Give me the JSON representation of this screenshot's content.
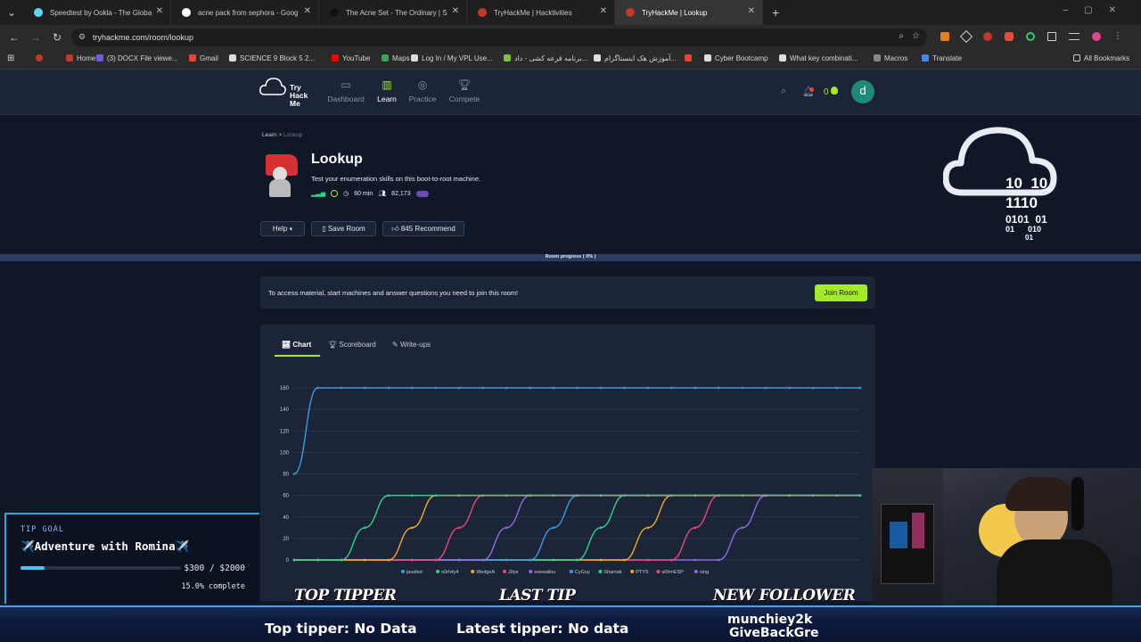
{
  "browser": {
    "tabs": [
      {
        "title": "Speedtest by Ookla - The Globa",
        "color": "#5ad7ff"
      },
      {
        "title": "acne pack from sephora - Goog",
        "color": "#ffffff"
      },
      {
        "title": "The Acne Set - The Ordinary | S",
        "color": "#111111"
      },
      {
        "title": "TryHackMe | Hacktivities",
        "color": "#c0392b"
      },
      {
        "title": "TryHackMe | Lookup",
        "color": "#c0392b"
      }
    ],
    "new_tab": "+",
    "url": "tryhackme.com/room/lookup",
    "bookmarks": [
      {
        "label": "Home",
        "color": "#c0392b"
      },
      {
        "label": "(3) DOCX File viewe...",
        "color": "#6c5ce7"
      },
      {
        "label": "Gmail",
        "color": "#ea4335"
      },
      {
        "label": "SCIENCE 9 Block 5 2...",
        "color": "#dddddd"
      },
      {
        "label": "YouTube",
        "color": "#ff0000"
      },
      {
        "label": "Maps",
        "color": "#34a853"
      },
      {
        "label": "Log In / My VPL Use...",
        "color": "#dddddd"
      },
      {
        "label": "برنامه قرعه کشی - داد...",
        "color": "#7cc242"
      },
      {
        "label": "آموزش هک اینستاگرام...",
        "color": "#dddddd"
      },
      {
        "label": "",
        "color": "#ea4335"
      },
      {
        "label": "Cyber Bootcamp",
        "color": "#dddddd"
      },
      {
        "label": "What key combinati...",
        "color": "#dddddd"
      },
      {
        "label": "Macros",
        "color": "#888888"
      },
      {
        "label": "Translate",
        "color": "#4285f4"
      }
    ],
    "all_bookmarks": "All Bookmarks"
  },
  "site": {
    "logo_text": "Try Hack Me",
    "nav": [
      {
        "label": "Dashboard",
        "icon": "dashboard-icon",
        "active": false
      },
      {
        "label": "Learn",
        "icon": "learn-icon",
        "active": true
      },
      {
        "label": "Practice",
        "icon": "practice-icon",
        "active": false
      },
      {
        "label": "Compete",
        "icon": "compete-icon",
        "active": false
      }
    ],
    "points": "0",
    "avatar_letter": "d",
    "accent": "#a3ea2a"
  },
  "room": {
    "breadcrumb": {
      "parent": "Learn",
      "separator": ">",
      "current": "Lookup"
    },
    "title": "Lookup",
    "description": "Test your enumeration skills on this boot-to-root machine.",
    "duration": "60 min",
    "users": "82,173",
    "buttons": {
      "help": "Help",
      "save": "Save Room",
      "recommend": "845 Recommend"
    },
    "progress_label": "Room progress ( 0% )",
    "progress": 0,
    "join_text": "To access material, start machines and answer questions you need to join this room!",
    "join_button": "Join Room",
    "binary_art": [
      "10  10",
      "1110",
      "0101  01",
      "01      010",
      "01"
    ]
  },
  "chart_tabs": [
    {
      "label": "Chart",
      "active": true
    },
    {
      "label": "Scoreboard",
      "active": false
    },
    {
      "label": "Write-ups",
      "active": false
    }
  ],
  "chart_data": {
    "type": "line",
    "title": "",
    "xlabel": "",
    "ylabel": "",
    "ylim": [
      0,
      160
    ],
    "yticks": [
      0,
      20,
      40,
      60,
      80,
      100,
      120,
      140,
      160
    ],
    "grid": true,
    "legend_position": "bottom",
    "points_per_series": 25,
    "series": [
      {
        "name": "jaxafed",
        "color": "#3b9ae1",
        "values": [
          80,
          160,
          160,
          160,
          160,
          160,
          160,
          160,
          160,
          160,
          160,
          160,
          160,
          160,
          160,
          160,
          160,
          160,
          160,
          160,
          160,
          160,
          160,
          160,
          160
        ]
      },
      {
        "name": "s0rh4y4",
        "color": "#2fd08a",
        "values": [
          0,
          0,
          0,
          30,
          60,
          60,
          60,
          60,
          60,
          60,
          60,
          60,
          60,
          60,
          60,
          60,
          60,
          60,
          60,
          60,
          60,
          60,
          60,
          60,
          60
        ]
      },
      {
        "name": "WedgeA",
        "color": "#f0a72b",
        "values": [
          0,
          0,
          0,
          0,
          0,
          30,
          60,
          60,
          60,
          60,
          60,
          60,
          60,
          60,
          60,
          60,
          60,
          60,
          60,
          60,
          60,
          60,
          60,
          60,
          60
        ]
      },
      {
        "name": "J0ye",
        "color": "#e8467c",
        "values": [
          0,
          0,
          0,
          0,
          0,
          0,
          0,
          30,
          60,
          60,
          60,
          60,
          60,
          60,
          60,
          60,
          60,
          60,
          60,
          60,
          60,
          60,
          60,
          60,
          60
        ]
      },
      {
        "name": "sowsaliou",
        "color": "#8e6be3",
        "values": [
          0,
          0,
          0,
          0,
          0,
          0,
          0,
          0,
          0,
          30,
          60,
          60,
          60,
          60,
          60,
          60,
          60,
          60,
          60,
          60,
          60,
          60,
          60,
          60,
          60
        ]
      },
      {
        "name": "CyGuy",
        "color": "#3b9ae1",
        "values": [
          0,
          0,
          0,
          0,
          0,
          0,
          0,
          0,
          0,
          0,
          0,
          30,
          60,
          60,
          60,
          60,
          60,
          60,
          60,
          60,
          60,
          60,
          60,
          60,
          60
        ]
      },
      {
        "name": "Shamak",
        "color": "#2fd08a",
        "values": [
          0,
          0,
          0,
          0,
          0,
          0,
          0,
          0,
          0,
          0,
          0,
          0,
          0,
          30,
          60,
          60,
          60,
          60,
          60,
          60,
          60,
          60,
          60,
          60,
          60
        ]
      },
      {
        "name": "PTYS",
        "color": "#f0a72b",
        "values": [
          0,
          0,
          0,
          0,
          0,
          0,
          0,
          0,
          0,
          0,
          0,
          0,
          0,
          0,
          0,
          30,
          60,
          60,
          60,
          60,
          60,
          60,
          60,
          60,
          60
        ]
      },
      {
        "name": "sl0rmESP",
        "color": "#e8467c",
        "values": [
          0,
          0,
          0,
          0,
          0,
          0,
          0,
          0,
          0,
          0,
          0,
          0,
          0,
          0,
          0,
          0,
          0,
          30,
          60,
          60,
          60,
          60,
          60,
          60,
          60
        ]
      },
      {
        "name": "ning",
        "color": "#8e6be3",
        "values": [
          0,
          0,
          0,
          0,
          0,
          0,
          0,
          0,
          0,
          0,
          0,
          0,
          0,
          0,
          0,
          0,
          0,
          0,
          0,
          30,
          60,
          60,
          60,
          60,
          60
        ]
      }
    ]
  },
  "stream": {
    "tip_goal_label": "TIP GOAL",
    "tip_goal_title": "✈️Adventure with Romina✈️",
    "tip_amount": "$300 / $2000",
    "tip_progress": 0.15,
    "tip_complete": "15.0% complete",
    "top_tipper_heading": "TOP TIPPER",
    "last_tip_heading": "LAST TIP",
    "new_follower_heading": "NEW FOLLOWER",
    "top_tipper_text": "Top tipper: No Data",
    "latest_tipper_text": "Latest tipper: No data",
    "followers": [
      "munchiey2k",
      "GiveBackGre"
    ]
  }
}
